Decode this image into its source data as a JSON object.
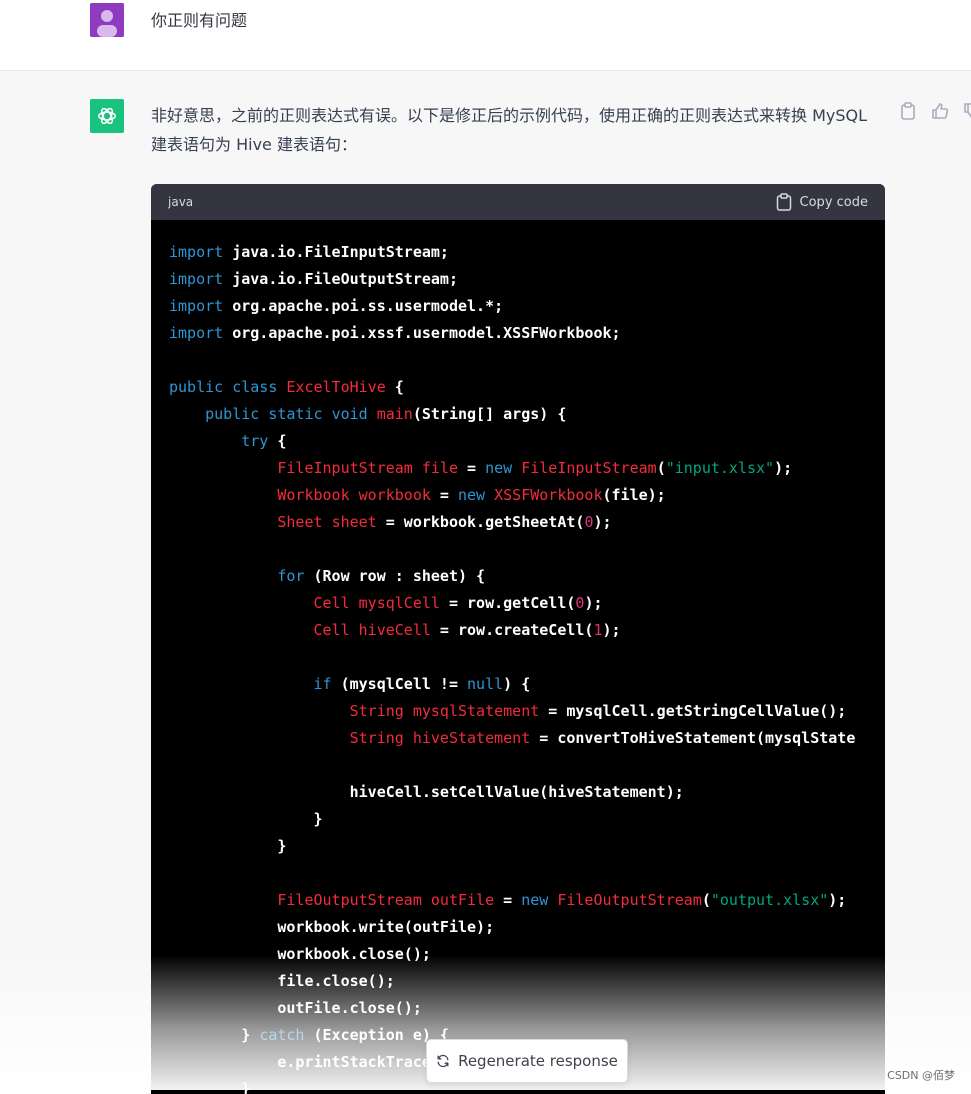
{
  "user_message": {
    "text": "你正则有问题"
  },
  "assistant_message": {
    "text": "非好意思，之前的正则表达式有误。以下是修正后的示例代码，使用正确的正则表达式来转换 MySQL 建表语句为 Hive 建表语句："
  },
  "code_block": {
    "language": "java",
    "copy_label": "Copy code"
  },
  "code_lines": [
    [
      [
        "kw",
        "import"
      ],
      [
        "p",
        " java.io.FileInputStream;"
      ]
    ],
    [
      [
        "kw",
        "import"
      ],
      [
        "p",
        " java.io.FileOutputStream;"
      ]
    ],
    [
      [
        "kw",
        "import"
      ],
      [
        "p",
        " org.apache.poi.ss.usermodel.*;"
      ]
    ],
    [
      [
        "kw",
        "import"
      ],
      [
        "p",
        " org.apache.poi.xssf.usermodel.XSSFWorkbook;"
      ]
    ],
    [],
    [
      [
        "kw",
        "public"
      ],
      [
        "p",
        " "
      ],
      [
        "kw",
        "class"
      ],
      [
        "p",
        " "
      ],
      [
        "ty",
        "ExcelToHive"
      ],
      [
        "p",
        " {"
      ]
    ],
    [
      [
        "p",
        "    "
      ],
      [
        "kw",
        "public"
      ],
      [
        "p",
        " "
      ],
      [
        "kw",
        "static"
      ],
      [
        "p",
        " "
      ],
      [
        "kw",
        "void"
      ],
      [
        "p",
        " "
      ],
      [
        "ty",
        "main"
      ],
      [
        "p",
        "(String[] args) {"
      ]
    ],
    [
      [
        "p",
        "        "
      ],
      [
        "kw",
        "try"
      ],
      [
        "p",
        " {"
      ]
    ],
    [
      [
        "p",
        "            "
      ],
      [
        "ty",
        "FileInputStream"
      ],
      [
        "p",
        " "
      ],
      [
        "ty",
        "file"
      ],
      [
        "p",
        " = "
      ],
      [
        "kw",
        "new"
      ],
      [
        "p",
        " "
      ],
      [
        "ty",
        "FileInputStream"
      ],
      [
        "p",
        "("
      ],
      [
        "st",
        "\"input.xlsx\""
      ],
      [
        "p",
        ");"
      ]
    ],
    [
      [
        "p",
        "            "
      ],
      [
        "ty",
        "Workbook"
      ],
      [
        "p",
        " "
      ],
      [
        "ty",
        "workbook"
      ],
      [
        "p",
        " = "
      ],
      [
        "kw",
        "new"
      ],
      [
        "p",
        " "
      ],
      [
        "ty",
        "XSSFWorkbook"
      ],
      [
        "p",
        "(file);"
      ]
    ],
    [
      [
        "p",
        "            "
      ],
      [
        "ty",
        "Sheet"
      ],
      [
        "p",
        " "
      ],
      [
        "ty",
        "sheet"
      ],
      [
        "p",
        " = workbook.getSheetAt("
      ],
      [
        "nm",
        "0"
      ],
      [
        "p",
        ");"
      ]
    ],
    [],
    [
      [
        "p",
        "            "
      ],
      [
        "kw",
        "for"
      ],
      [
        "p",
        " (Row row : sheet) {"
      ]
    ],
    [
      [
        "p",
        "                "
      ],
      [
        "ty",
        "Cell"
      ],
      [
        "p",
        " "
      ],
      [
        "ty",
        "mysqlCell"
      ],
      [
        "p",
        " = row.getCell("
      ],
      [
        "nm",
        "0"
      ],
      [
        "p",
        ");"
      ]
    ],
    [
      [
        "p",
        "                "
      ],
      [
        "ty",
        "Cell"
      ],
      [
        "p",
        " "
      ],
      [
        "ty",
        "hiveCell"
      ],
      [
        "p",
        " = row.createCell("
      ],
      [
        "nm",
        "1"
      ],
      [
        "p",
        ");"
      ]
    ],
    [],
    [
      [
        "p",
        "                "
      ],
      [
        "kw",
        "if"
      ],
      [
        "p",
        " (mysqlCell != "
      ],
      [
        "kw",
        "null"
      ],
      [
        "p",
        ") {"
      ]
    ],
    [
      [
        "p",
        "                    "
      ],
      [
        "ty",
        "String"
      ],
      [
        "p",
        " "
      ],
      [
        "ty",
        "mysqlStatement"
      ],
      [
        "p",
        " = mysqlCell.getStringCellValue();"
      ]
    ],
    [
      [
        "p",
        "                    "
      ],
      [
        "ty",
        "String"
      ],
      [
        "p",
        " "
      ],
      [
        "ty",
        "hiveStatement"
      ],
      [
        "p",
        " = convertToHiveStatement(mysqlState"
      ]
    ],
    [],
    [
      [
        "p",
        "                    hiveCell.setCellValue(hiveStatement);"
      ]
    ],
    [
      [
        "p",
        "                }"
      ]
    ],
    [
      [
        "p",
        "            }"
      ]
    ],
    [],
    [
      [
        "p",
        "            "
      ],
      [
        "ty",
        "FileOutputStream"
      ],
      [
        "p",
        " "
      ],
      [
        "ty",
        "outFile"
      ],
      [
        "p",
        " = "
      ],
      [
        "kw",
        "new"
      ],
      [
        "p",
        " "
      ],
      [
        "ty",
        "FileOutputStream"
      ],
      [
        "p",
        "("
      ],
      [
        "st",
        "\"output.xlsx\""
      ],
      [
        "p",
        ");"
      ]
    ],
    [
      [
        "p",
        "            workbook.write(outFile);"
      ]
    ],
    [
      [
        "p",
        "            workbook.close();"
      ]
    ],
    [
      [
        "p",
        "            file.close();"
      ]
    ],
    [
      [
        "p",
        "            outFile.close();"
      ]
    ],
    [
      [
        "p",
        "        } "
      ],
      [
        "kw",
        "catch"
      ],
      [
        "p",
        " (Exception e) {"
      ]
    ],
    [
      [
        "p",
        "            e.printStackTrace();"
      ]
    ],
    [
      [
        "p",
        "        }"
      ]
    ]
  ],
  "regenerate": {
    "label": "Regenerate response"
  },
  "watermark": {
    "text": "CSDN @佰梦"
  }
}
